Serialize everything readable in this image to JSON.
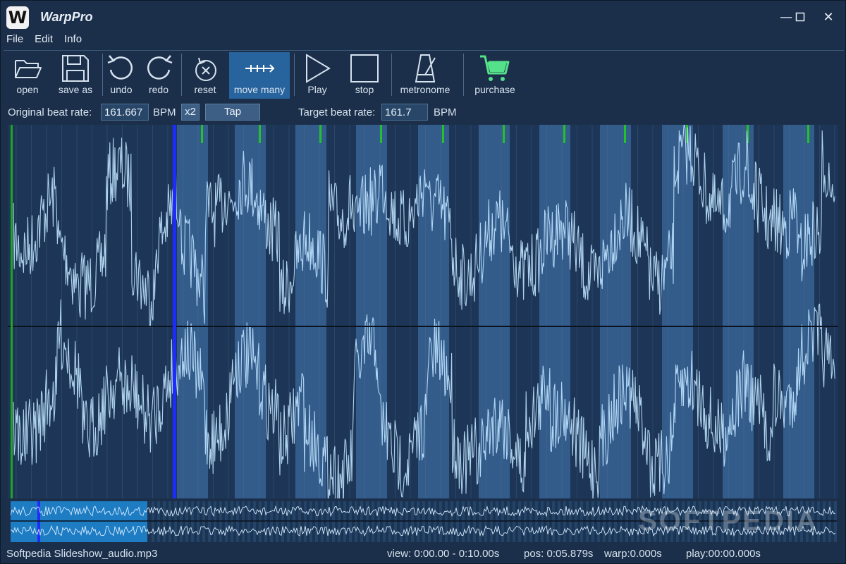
{
  "app": {
    "title": "WarpPro",
    "logo_letter": "W"
  },
  "window_controls": {
    "minimize": "—",
    "maximize": "☐",
    "close": "✕"
  },
  "menu": [
    "File",
    "Edit",
    "Info"
  ],
  "toolbar": {
    "open": "open",
    "save_as": "save as",
    "undo": "undo",
    "redo": "redo",
    "reset": "reset",
    "move_many": "move many",
    "play": "Play",
    "stop": "stop",
    "metronome": "metronome",
    "purchase": "purchase"
  },
  "beat": {
    "original_label": "Original beat rate:",
    "original_value": "161.667",
    "bpm_unit": "BPM",
    "x2_label": "x2",
    "tap_label": "Tap",
    "target_label": "Target beat rate:",
    "target_value": "161.7"
  },
  "status": {
    "filename": "Softpedia Slideshow_audio.mp3",
    "view": "view: 0:00.00 - 0:10.00s",
    "pos": "pos: 0:05.879s",
    "warp": "warp:0.000s",
    "play": "play:00:00.000s"
  },
  "watermark": "SOFTPEDIA",
  "colors": {
    "background": "#1b2f4a",
    "active_tool": "#27649e",
    "waveform": "#bfe3ff",
    "beat_band": "#3b6a9c",
    "beat_marker": "#23c22b",
    "playhead": "#1e2bff",
    "start_marker": "#1fa51f",
    "purchase_cart": "#55e08a",
    "overview_highlight": "#1f8fe0"
  }
}
